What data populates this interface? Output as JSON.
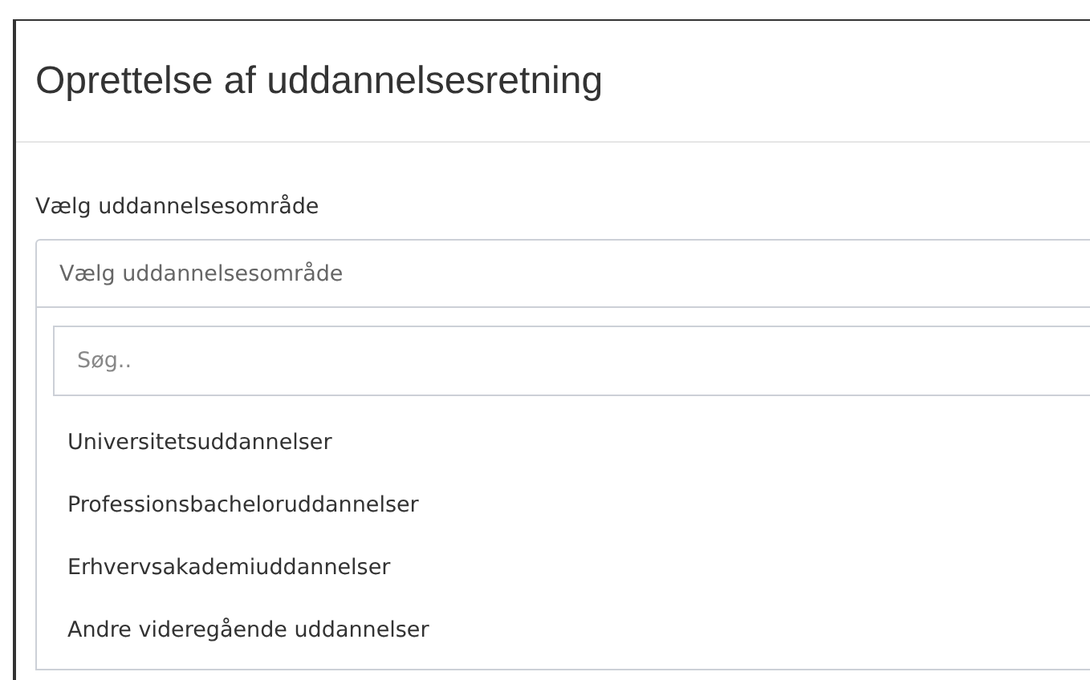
{
  "dialog": {
    "title": "Oprettelse af uddannelsesretning"
  },
  "field": {
    "label": "Vælg uddannelsesområde",
    "placeholder": "Vælg uddannelsesområde"
  },
  "dropdown": {
    "search": {
      "placeholder": "Søg.."
    },
    "options": [
      {
        "label": "Universitetsuddannelser"
      },
      {
        "label": "Professionsbacheloruddannelser"
      },
      {
        "label": "Erhvervsakademiuddannelser"
      },
      {
        "label": "Andre videregående uddannelser"
      }
    ]
  }
}
